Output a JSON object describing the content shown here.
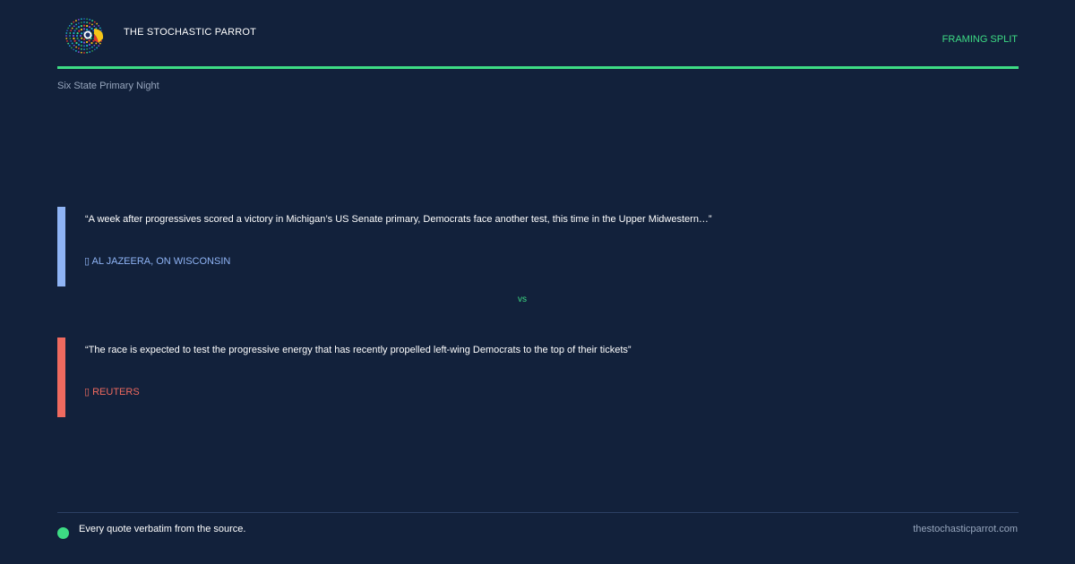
{
  "header": {
    "brand_name": "THE STOCHASTIC PARROT",
    "section_label": "FRAMING SPLIT",
    "logo_icon": "parrot-logo-icon"
  },
  "event_title": "Six State Primary Night",
  "quotes": [
    {
      "text": "“A week after progressives scored a victory in Michigan’s US Senate primary, Democrats face another test, this time in the Upper Midwestern…”",
      "source": "▯ AL JAZEERA, ON WISCONSIN",
      "accent_color": "#8fb4f5"
    },
    {
      "text": "“The race is expected to test the progressive energy that has recently propelled left-wing Democrats to the top of their tickets”",
      "source": "▯ REUTERS",
      "accent_color": "#ef6a5f"
    }
  ],
  "divider_label": "vs",
  "footer": {
    "note": "Every quote verbatim from the source.",
    "url": "thestochasticparrot.com"
  },
  "colors": {
    "background": "#12213b",
    "accent": "#3ddc84",
    "muted": "#97a6bd"
  }
}
